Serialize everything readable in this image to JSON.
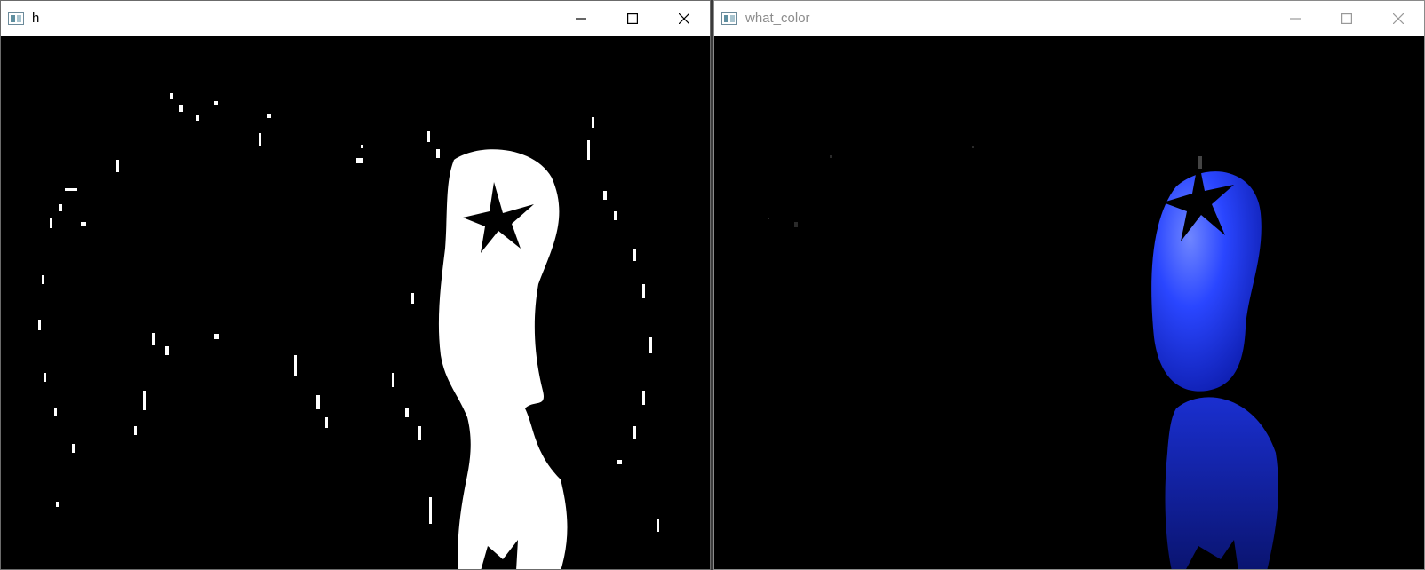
{
  "windows": [
    {
      "title": "h",
      "controls": {
        "minimize": "minimize-icon",
        "maximize": "maximize-icon",
        "close": "close-icon"
      },
      "active": true
    },
    {
      "title": "what_color",
      "controls": {
        "minimize": "minimize-icon",
        "maximize": "maximize-icon",
        "close": "close-icon"
      },
      "active": false
    }
  ],
  "colors": {
    "title_active": "#000000",
    "title_inactive": "#8c8c8c",
    "mask_white": "#ffffff",
    "tomato_blue": "#1f3cff"
  }
}
